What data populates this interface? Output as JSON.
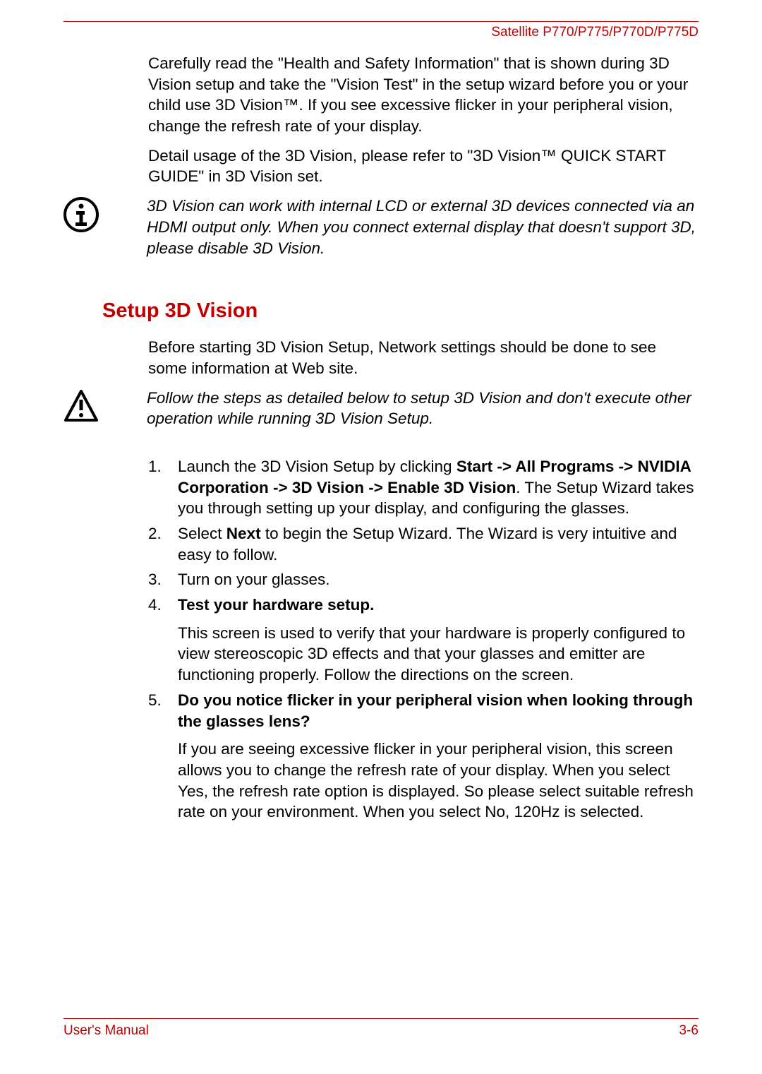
{
  "header": {
    "product": "Satellite P770/P775/P770D/P775D"
  },
  "para1": "Carefully read the \"Health and Safety Information\" that is shown during 3D Vision setup and take the \"Vision Test\" in the setup wizard before you or your child use 3D Vision™. If you see excessive flicker in your peripheral vision, change the refresh rate of your display.",
  "para2": "Detail usage of the 3D Vision, please refer to \"3D Vision™ QUICK START GUIDE\" in 3D Vision set.",
  "note1": "3D Vision can work with internal LCD or external 3D devices connected via an HDMI output only. When you connect external display that doesn't support 3D, please disable 3D Vision.",
  "section_heading": "Setup 3D Vision",
  "para3": "Before starting 3D Vision Setup, Network settings should be done to see some information at Web site.",
  "note2": "Follow the steps as detailed below to setup 3D Vision and don't execute other operation while running 3D Vision Setup.",
  "steps": {
    "s1_pre": "Launch the 3D Vision Setup by clicking ",
    "s1_bold": "Start -> All Programs -> NVIDIA Corporation -> 3D Vision -> Enable 3D Vision",
    "s1_post": ". The Setup Wizard takes you through setting up your display, and configuring the glasses.",
    "s2_pre": "Select ",
    "s2_bold": "Next",
    "s2_post": " to begin the Setup Wizard. The Wizard is very intuitive and easy to follow.",
    "s3": "Turn on your glasses.",
    "s4_bold": "Test your hardware setup.",
    "s4_sub": "This screen is used to verify that your hardware is properly configured to view stereoscopic 3D effects and that your glasses and emitter are functioning properly. Follow the directions on the screen.",
    "s5_bold": "Do you notice flicker in your peripheral vision when looking through the glasses lens?",
    "s5_sub": "If you are seeing excessive flicker in your peripheral vision, this screen allows you to change the refresh rate of your display. When you select Yes, the refresh rate option is displayed. So please select suitable refresh rate on your environment. When you select No, 120Hz is selected."
  },
  "footer": {
    "left": "User's Manual",
    "right": "3-6"
  }
}
